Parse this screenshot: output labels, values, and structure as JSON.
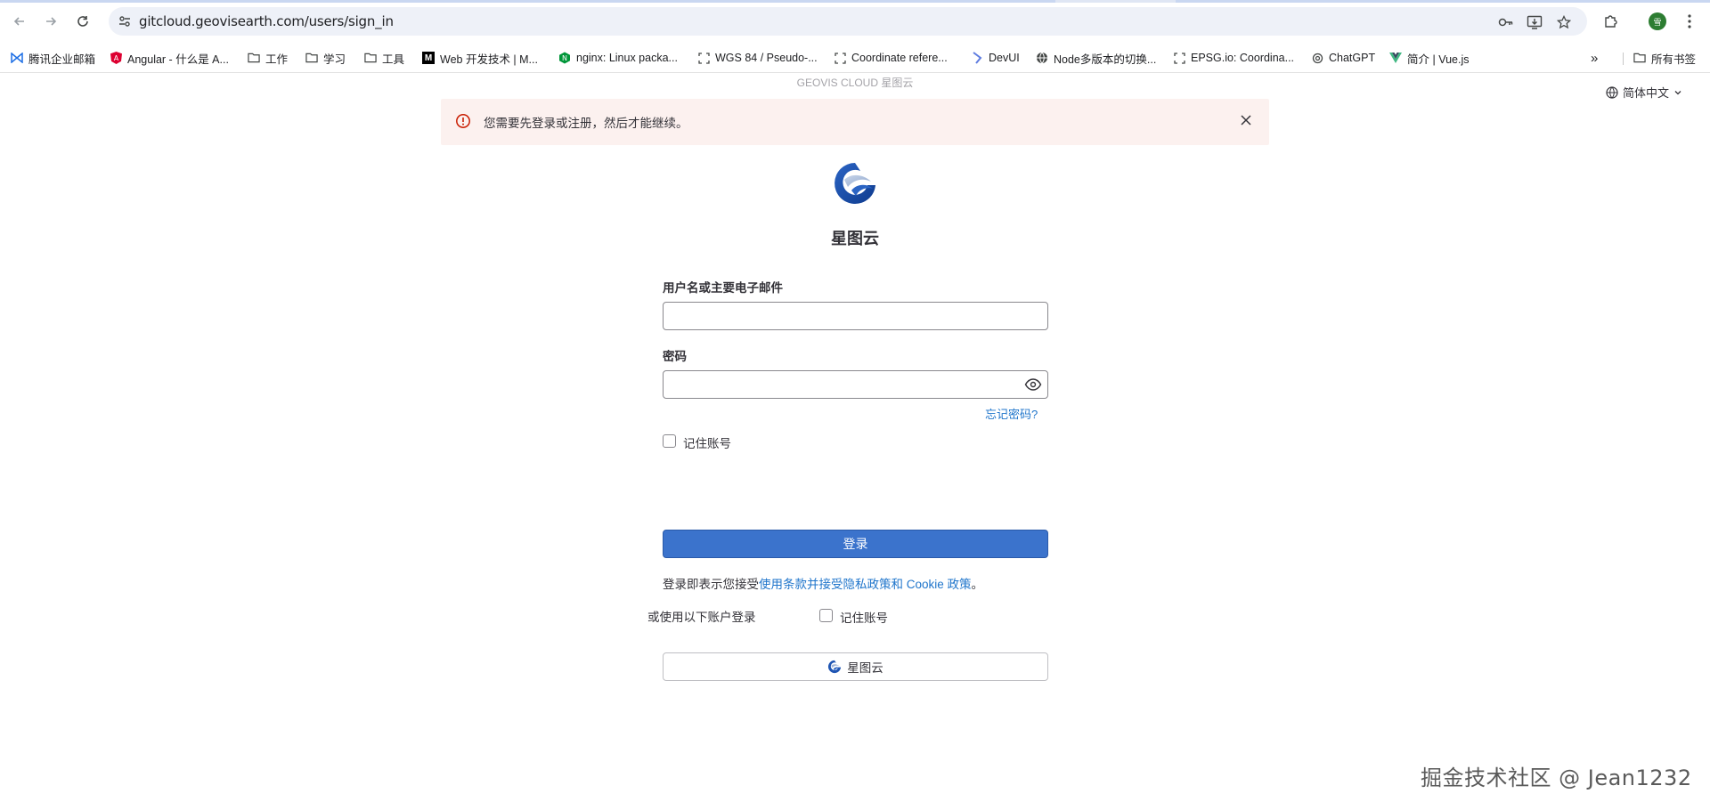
{
  "browser": {
    "url": "gitcloud.geovisearth.com/users/sign_in",
    "profile_initial": "雪",
    "icons": {
      "back": "arrow-left-icon",
      "forward": "arrow-right-icon",
      "reload": "reload-icon",
      "site_info": "tune-icon",
      "password": "key-icon",
      "install": "install-app-icon",
      "bookmark": "star-icon",
      "extensions": "puzzle-icon",
      "menu": "kebab-menu-icon"
    }
  },
  "bookmarks": [
    {
      "label": "腾讯企业邮箱",
      "icon": "tencent-mail-icon"
    },
    {
      "label": "Angular - 什么是 A...",
      "icon": "angular-icon"
    },
    {
      "label": "工作",
      "icon": "folder-icon"
    },
    {
      "label": "学习",
      "icon": "folder-icon"
    },
    {
      "label": "工具",
      "icon": "folder-icon"
    },
    {
      "label": "Web 开发技术 | M...",
      "icon": "mdn-icon"
    },
    {
      "label": "nginx: Linux packa...",
      "icon": "nginx-icon"
    },
    {
      "label": "WGS 84 / Pseudo-...",
      "icon": "epsg-icon"
    },
    {
      "label": "Coordinate refere...",
      "icon": "epsg-icon"
    },
    {
      "label": "DevUI",
      "icon": "devui-icon"
    },
    {
      "label": "Node多版本的切换...",
      "icon": "globe-icon"
    },
    {
      "label": "EPSG.io: Coordina...",
      "icon": "epsg-icon"
    },
    {
      "label": "ChatGPT",
      "icon": "chatgpt-icon"
    },
    {
      "label": "简介 | Vue.js",
      "icon": "vue-icon"
    }
  ],
  "bookmarks_overflow": "»",
  "all_bookmarks": "所有书签",
  "page": {
    "brand_header": "GEOVIS CLOUD 星图云",
    "language": "简体中文",
    "alert_message": "您需要先登录或注册，然后才能继续。",
    "app_title": "星图云",
    "username_label": "用户名或主要电子邮件",
    "username_value": "",
    "password_label": "密码",
    "password_value": "",
    "forgot_password": "忘记密码?",
    "remember_me": "记住账号",
    "login_button": "登录",
    "terms_prefix": "登录即表示您接受",
    "terms_link": "使用条款并接受隐私政策和 Cookie 政策",
    "terms_suffix": "。",
    "alt_login_text": "或使用以下账户登录",
    "oauth_button": "星图云",
    "oauth_remember": "记住账号"
  },
  "watermark": "掘金技术社区 @ Jean1232",
  "colors": {
    "primary": "#3b73cc",
    "link": "#1f75cb",
    "alert_bg": "#fcf1ef",
    "alert_icon": "#c91c00"
  }
}
